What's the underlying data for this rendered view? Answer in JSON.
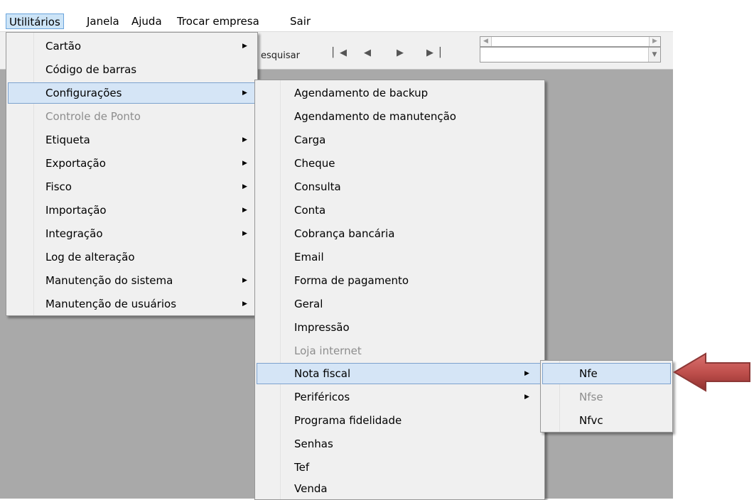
{
  "menubar": {
    "items": [
      {
        "label": "Utilitários",
        "active": true
      },
      {
        "label": "Janela"
      },
      {
        "label": "Ajuda"
      },
      {
        "label": "Trocar empresa"
      },
      {
        "label": "Sair"
      }
    ]
  },
  "toolbar": {
    "search_label_partial": "esquisar",
    "nav": [
      "first-record-icon",
      "previous-record-icon",
      "next-record-icon",
      "last-record-icon"
    ]
  },
  "utilitarios_menu": {
    "items": [
      {
        "label": "Cartão",
        "submenu": true
      },
      {
        "label": "Código de barras"
      },
      {
        "label": "Configurações",
        "submenu": true,
        "highlighted": true
      },
      {
        "label": "Controle de Ponto",
        "disabled": true
      },
      {
        "label": "Etiqueta",
        "submenu": true
      },
      {
        "label": "Exportação",
        "submenu": true
      },
      {
        "label": "Fisco",
        "submenu": true
      },
      {
        "label": "Importação",
        "submenu": true
      },
      {
        "label": "Integração",
        "submenu": true
      },
      {
        "label": "Log de alteração"
      },
      {
        "label": "Manutenção do sistema",
        "submenu": true
      },
      {
        "label": "Manutenção de usuários",
        "submenu": true
      }
    ]
  },
  "configuracoes_menu": {
    "items": [
      {
        "label": "Agendamento de backup"
      },
      {
        "label": "Agendamento de manutenção"
      },
      {
        "label": "Carga"
      },
      {
        "label": "Cheque"
      },
      {
        "label": "Consulta"
      },
      {
        "label": "Conta"
      },
      {
        "label": "Cobrança bancária"
      },
      {
        "label": "Email"
      },
      {
        "label": "Forma de pagamento"
      },
      {
        "label": "Geral"
      },
      {
        "label": "Impressão"
      },
      {
        "label": "Loja internet",
        "disabled": true
      },
      {
        "label": "Nota fiscal",
        "submenu": true,
        "highlighted": true
      },
      {
        "label": "Periféricos",
        "submenu": true
      },
      {
        "label": "Programa fidelidade"
      },
      {
        "label": "Senhas"
      },
      {
        "label": "Tef"
      },
      {
        "label": "Venda"
      }
    ]
  },
  "nota_fiscal_menu": {
    "items": [
      {
        "label": "Nfe",
        "highlighted": true
      },
      {
        "label": "Nfse",
        "disabled": true
      },
      {
        "label": "Nfvc"
      }
    ]
  },
  "colors": {
    "workspace": "#a9a9a9",
    "menu_bg": "#f0f0f0",
    "highlight": "#d5e5f6",
    "highlight_border": "#7da2ce",
    "callout_arrow": "#c0504d"
  }
}
